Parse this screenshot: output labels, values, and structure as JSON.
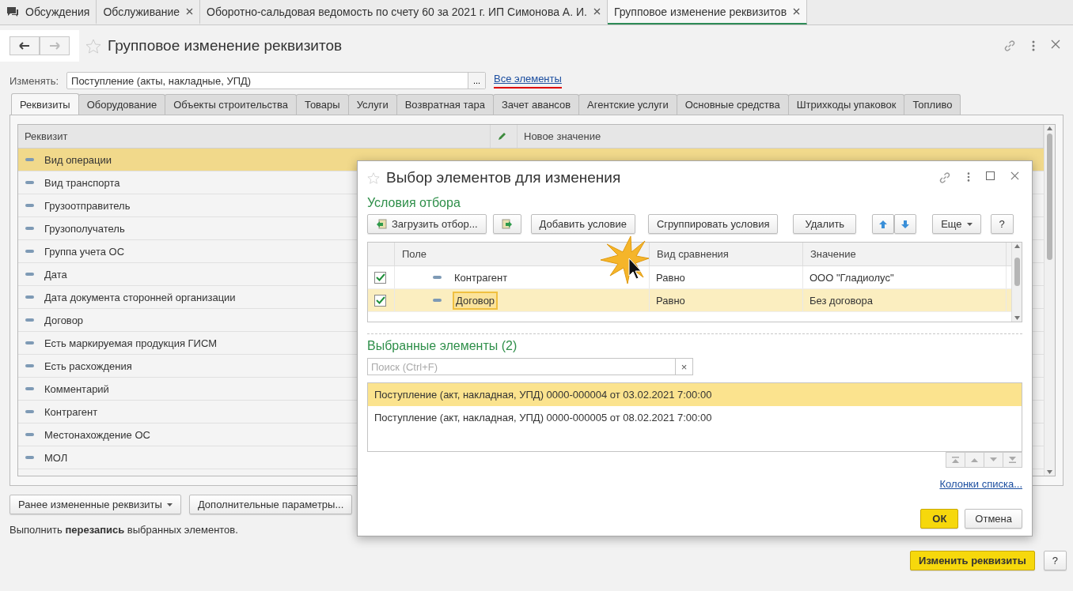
{
  "app_tabs": [
    {
      "label": "Обсуждения",
      "kind": "chat",
      "selected": false
    },
    {
      "label": "Обслуживание",
      "kind": "closable",
      "selected": false
    },
    {
      "label": "Оборотно-сальдовая ведомость по счету 60 за 2021 г. ИП Симонова А. И.",
      "kind": "closable",
      "selected": false
    },
    {
      "label": "Групповое изменение реквизитов",
      "kind": "closable",
      "selected": true
    }
  ],
  "page": {
    "title": "Групповое изменение реквизитов",
    "change_label": "Изменять:",
    "change_value": "Поступление (акты, накладные, УПД)",
    "select_button": "...",
    "all_link": "Все элементы",
    "tabs": [
      {
        "label": "Реквизиты",
        "selected": true
      },
      {
        "label": "Оборудование",
        "selected": false
      },
      {
        "label": "Объекты строительства",
        "selected": false
      },
      {
        "label": "Товары",
        "selected": false
      },
      {
        "label": "Услуги",
        "selected": false
      },
      {
        "label": "Возвратная тара",
        "selected": false
      },
      {
        "label": "Зачет авансов",
        "selected": false
      },
      {
        "label": "Агентские услуги",
        "selected": false
      },
      {
        "label": "Основные средства",
        "selected": false
      },
      {
        "label": "Штрихкоды упаковок",
        "selected": false
      },
      {
        "label": "Топливо",
        "selected": false
      }
    ],
    "table": {
      "columns": [
        "Реквизит",
        "Новое значение"
      ],
      "rows": [
        {
          "label": "Вид операции",
          "selected": true
        },
        {
          "label": "Вид транспорта",
          "selected": false
        },
        {
          "label": "Грузоотправитель",
          "selected": false
        },
        {
          "label": "Грузополучатель",
          "selected": false
        },
        {
          "label": "Группа учета ОС",
          "selected": false
        },
        {
          "label": "Дата",
          "selected": false
        },
        {
          "label": "Дата документа сторонней организации",
          "selected": false
        },
        {
          "label": "Договор",
          "selected": false
        },
        {
          "label": "Есть маркируемая продукция ГИСМ",
          "selected": false
        },
        {
          "label": "Есть расхождения",
          "selected": false
        },
        {
          "label": "Комментарий",
          "selected": false
        },
        {
          "label": "Контрагент",
          "selected": false
        },
        {
          "label": "Местонахождение ОС",
          "selected": false
        },
        {
          "label": "МОЛ",
          "selected": false
        }
      ]
    },
    "buttons": [
      {
        "label": "Ранее измененные реквизиты",
        "dropdown": true
      },
      {
        "label": "Дополнительные параметры...",
        "dropdown": false
      }
    ],
    "note": "Выполнить **перезапись** выбранных элементов.",
    "submit": "Изменить реквизиты",
    "help": "?"
  },
  "dialog": {
    "title": "Выбор элементов для изменения",
    "conditions_title": "Условия отбора",
    "toolbar": {
      "load": "Загрузить отбор...",
      "add": "Добавить условие",
      "group": "Сгруппировать условия",
      "delete": "Удалить",
      "more": "Еще",
      "help": "?"
    },
    "filter": {
      "columns": [
        "Поле",
        "Вид сравнения",
        "Значение"
      ],
      "rows": [
        {
          "checked": true,
          "field": "Контрагент",
          "comparison": "Равно",
          "value": "ООО \"Гладиолус\"",
          "selected": false
        },
        {
          "checked": true,
          "field": "Договор",
          "comparison": "Равно",
          "value": "Без договора",
          "selected": true
        }
      ]
    },
    "selected_title": "Выбранные элементы (2)",
    "search_placeholder": "Поиск (Ctrl+F)",
    "clear": "×",
    "items": [
      {
        "label": "Поступление (акт, накладная, УПД) 0000-000004 от 03.02.2021 7:00:00",
        "selected": true
      },
      {
        "label": "Поступление (акт, накладная, УПД) 0000-000005 от 08.02.2021 7:00:00",
        "selected": false
      }
    ],
    "columns_link": "Колонки списка...",
    "ok": "ОК",
    "cancel": "Отмена"
  }
}
